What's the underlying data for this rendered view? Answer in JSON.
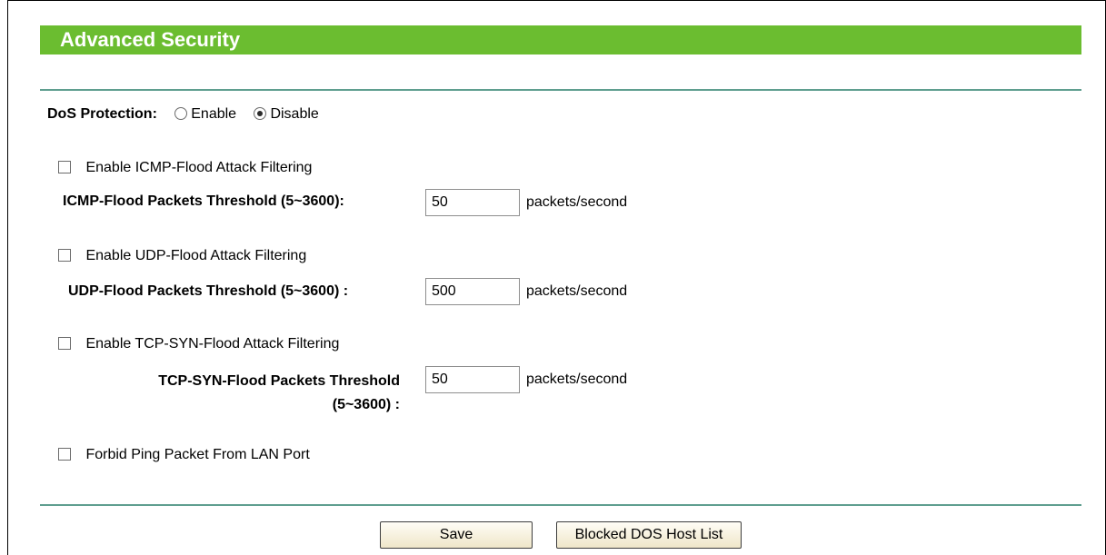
{
  "header": {
    "title": "Advanced Security"
  },
  "dos": {
    "label": "DoS Protection:",
    "enable_label": "Enable",
    "disable_label": "Disable",
    "selected": "Disable"
  },
  "icmp": {
    "checkbox_label": "Enable ICMP-Flood Attack Filtering",
    "checked": false,
    "threshold_label": "ICMP-Flood Packets Threshold (5~3600):",
    "value": "50",
    "unit": "packets/second"
  },
  "udp": {
    "checkbox_label": "Enable UDP-Flood Attack Filtering",
    "checked": false,
    "threshold_label": "UDP-Flood Packets Threshold (5~3600) :",
    "value": "500",
    "unit": "packets/second"
  },
  "tcp": {
    "checkbox_label": "Enable TCP-SYN-Flood Attack Filtering",
    "checked": false,
    "threshold_label_line1": "TCP-SYN-Flood Packets Threshold",
    "threshold_label_line2": "(5~3600) :",
    "value": "50",
    "unit": "packets/second"
  },
  "ping": {
    "checkbox_label": "Forbid Ping Packet From LAN Port",
    "checked": false
  },
  "buttons": {
    "save_label": "Save",
    "blocked_list_label": "Blocked DOS Host List"
  },
  "colors": {
    "header_green": "#6bbd30",
    "rule_teal": "#5f9e8f"
  }
}
